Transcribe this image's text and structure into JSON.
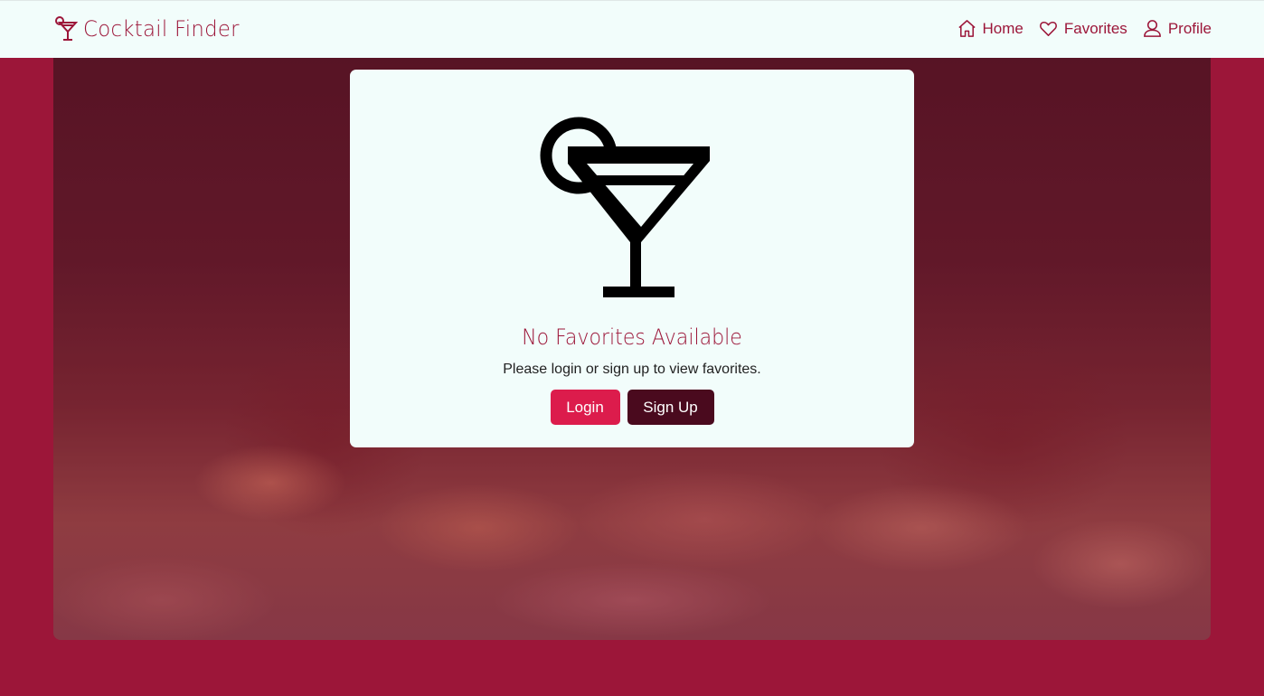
{
  "brand": {
    "name": "Cocktail Finder",
    "icon": "cocktail-icon",
    "color": "#9c1639"
  },
  "nav": {
    "items": [
      {
        "label": "Home",
        "icon": "home-icon"
      },
      {
        "label": "Favorites",
        "icon": "heart-icon"
      },
      {
        "label": "Profile",
        "icon": "user-icon"
      }
    ]
  },
  "empty_state": {
    "icon": "cocktail-glass-icon",
    "title": "No Favorites Available",
    "message": "Please login or sign up to view favorites.",
    "login_label": "Login",
    "signup_label": "Sign Up"
  },
  "colors": {
    "page_background": "#9c1639",
    "navbar_background": "#f2fdfb",
    "login_button": "#dc1c4c",
    "signup_button": "#4a0a1e"
  }
}
